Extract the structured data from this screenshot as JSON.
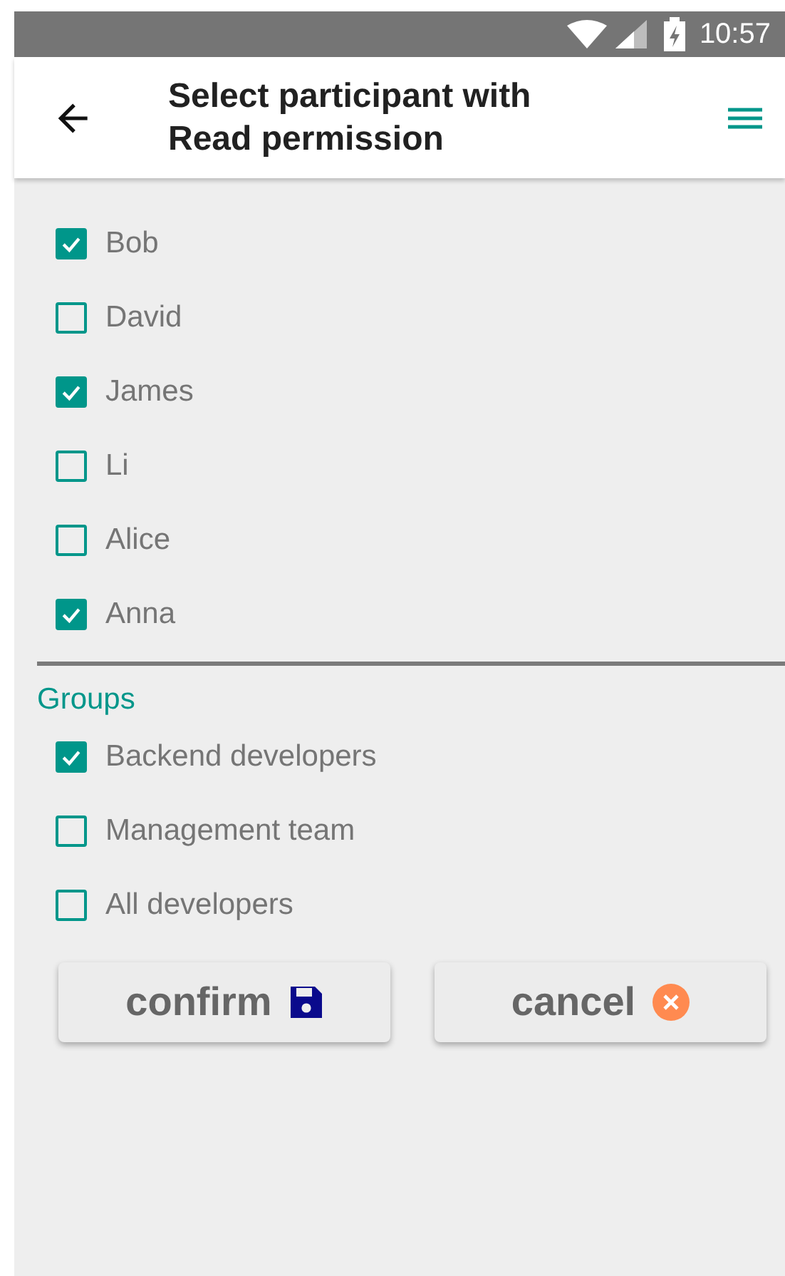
{
  "status_bar": {
    "time": "10:57"
  },
  "toolbar": {
    "title": "Select participant with Read permission"
  },
  "participants": [
    {
      "name": "Bob",
      "checked": true
    },
    {
      "name": "David",
      "checked": false
    },
    {
      "name": "James",
      "checked": true
    },
    {
      "name": "Li",
      "checked": false
    },
    {
      "name": "Alice",
      "checked": false
    },
    {
      "name": "Anna",
      "checked": true
    }
  ],
  "groups": {
    "heading": "Groups",
    "items": [
      {
        "name": "Backend developers",
        "checked": true
      },
      {
        "name": "Management team",
        "checked": false
      },
      {
        "name": "All developers",
        "checked": false
      }
    ]
  },
  "buttons": [
    {
      "label": "confirm",
      "kind": "confirm"
    },
    {
      "label": "cancel",
      "kind": "cancel"
    }
  ]
}
